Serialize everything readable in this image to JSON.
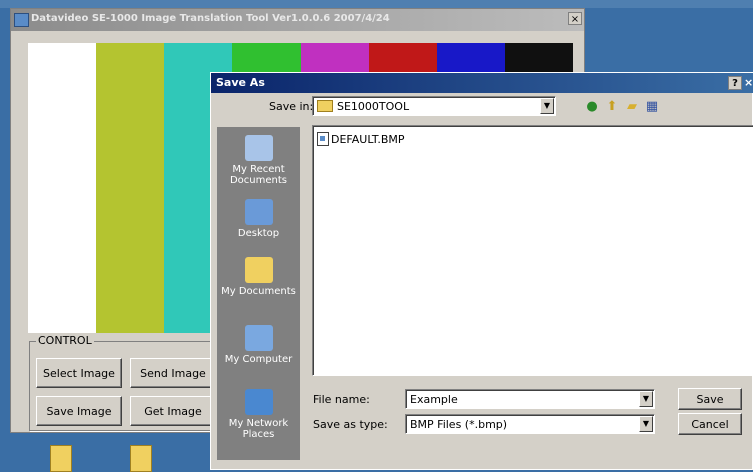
{
  "background_window": {
    "title": "Datavideo SE-1000 Image Translation Tool Ver1.0.0.6 2007/4/24",
    "close_label": "×",
    "color_bars": [
      "#ffffff",
      "#b4c430",
      "#30c8b8",
      "#30c030",
      "#c030c0",
      "#c01818",
      "#1818c8",
      "#101010"
    ],
    "control": {
      "group_label": "CONTROL",
      "buttons": [
        "Select Image",
        "Send Image",
        "Save Image",
        "Get Image"
      ]
    }
  },
  "dialog": {
    "title": "Save As",
    "help_label": "?",
    "close_label": "×",
    "save_in_label": "Save in:",
    "save_in_value": "SE1000TOOL",
    "places": [
      {
        "label": "My Recent\nDocuments",
        "icon": "recent-documents-icon"
      },
      {
        "label": "Desktop",
        "icon": "desktop-icon"
      },
      {
        "label": "My Documents",
        "icon": "my-documents-icon"
      },
      {
        "label": "My Computer",
        "icon": "my-computer-icon"
      },
      {
        "label": "My Network\nPlaces",
        "icon": "network-places-icon"
      }
    ],
    "files": [
      "DEFAULT.BMP"
    ],
    "file_name_label": "File name:",
    "file_name_value": "Example",
    "save_as_type_label": "Save as type:",
    "save_as_type_value": "BMP Files (*.bmp)",
    "save_button": "Save",
    "cancel_button": "Cancel"
  }
}
